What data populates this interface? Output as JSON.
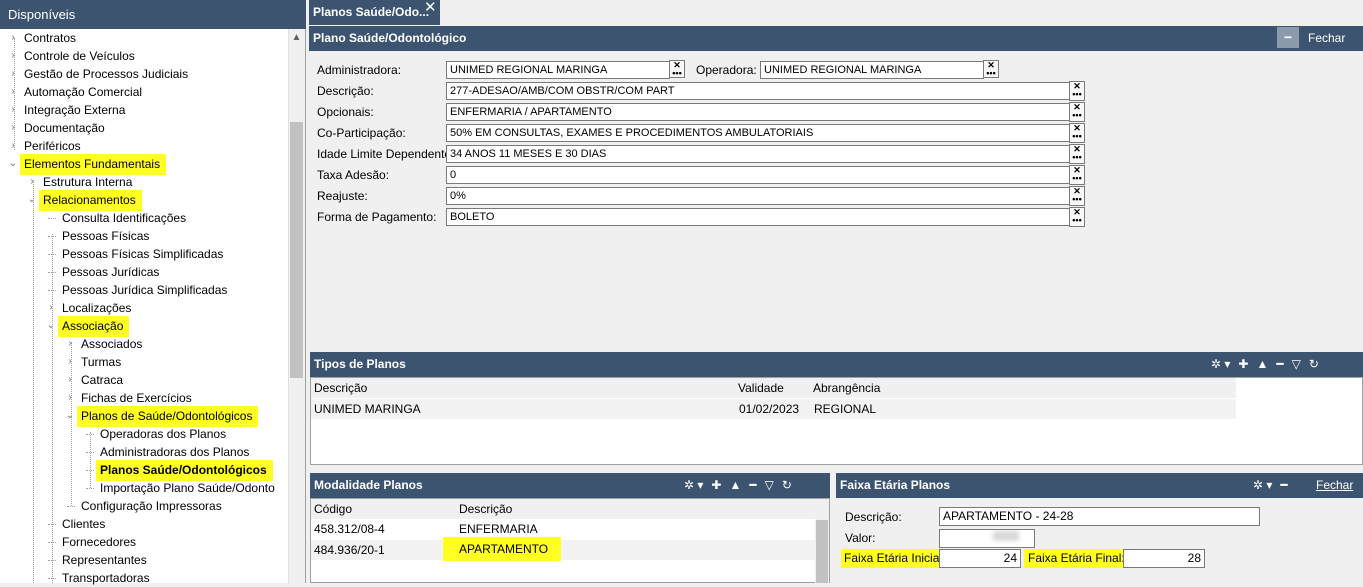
{
  "tree": {
    "title": "Disponíveis",
    "items": [
      {
        "label": "Contratos",
        "level": 0,
        "arrow": ">"
      },
      {
        "label": "Controle de Veículos",
        "level": 0,
        "arrow": ">"
      },
      {
        "label": "Gestão de Processos Judiciais",
        "level": 0,
        "arrow": ">"
      },
      {
        "label": "Automação Comercial",
        "level": 0,
        "arrow": ">"
      },
      {
        "label": "Integração Externa",
        "level": 0,
        "arrow": ">"
      },
      {
        "label": "Documentação",
        "level": 0,
        "arrow": ">"
      },
      {
        "label": "Periféricos",
        "level": 0,
        "arrow": ">"
      },
      {
        "label": "Elementos Fundamentais",
        "level": 0,
        "arrow": "v",
        "highlight": true
      },
      {
        "label": "Estrutura Interna",
        "level": 1,
        "arrow": ">"
      },
      {
        "label": "Relacionamentos",
        "level": 1,
        "arrow": "v",
        "highlight": true
      },
      {
        "label": "Consulta Identificações",
        "level": 2,
        "arrow": ""
      },
      {
        "label": "Pessoas Físicas",
        "level": 2,
        "arrow": ""
      },
      {
        "label": "Pessoas Físicas Simplificadas",
        "level": 2,
        "arrow": ""
      },
      {
        "label": "Pessoas Jurídicas",
        "level": 2,
        "arrow": ""
      },
      {
        "label": "Pessoas Jurídica Simplificadas",
        "level": 2,
        "arrow": ""
      },
      {
        "label": "Localizações",
        "level": 2,
        "arrow": ">"
      },
      {
        "label": "Associação",
        "level": 2,
        "arrow": "v",
        "highlight": true
      },
      {
        "label": "Associados",
        "level": 3,
        "arrow": ">"
      },
      {
        "label": "Turmas",
        "level": 3,
        "arrow": ">"
      },
      {
        "label": "Catraca",
        "level": 3,
        "arrow": ">"
      },
      {
        "label": "Fichas de Exercícios",
        "level": 3,
        "arrow": ">"
      },
      {
        "label": "Planos de Saúde/Odontológicos",
        "level": 3,
        "arrow": "v",
        "highlight": true
      },
      {
        "label": "Operadoras dos Planos",
        "level": 4,
        "arrow": ""
      },
      {
        "label": "Administradoras dos Planos",
        "level": 4,
        "arrow": ""
      },
      {
        "label": "Planos Saúde/Odontológicos",
        "level": 4,
        "arrow": "",
        "highlight": true,
        "bold": true
      },
      {
        "label": "Importação Plano Saúde/Odonto",
        "level": 4,
        "arrow": ""
      },
      {
        "label": "Configuração Impressoras",
        "level": 3,
        "arrow": ""
      },
      {
        "label": "Clientes",
        "level": 2,
        "arrow": ""
      },
      {
        "label": "Fornecedores",
        "level": 2,
        "arrow": ""
      },
      {
        "label": "Representantes",
        "level": 2,
        "arrow": ""
      },
      {
        "label": "Transportadoras",
        "level": 2,
        "arrow": ""
      }
    ]
  },
  "tab": {
    "label": "Planos Saúde/Odo...",
    "close": "✕"
  },
  "main": {
    "title": "Plano Saúde/Odontológico",
    "minimize": "−",
    "close_label": "Fechar",
    "administradora_label": "Administradora:",
    "administradora_value": "UNIMED REGIONAL MARINGA",
    "operadora_label": "Operadora:",
    "operadora_value": "UNIMED REGIONAL MARINGA",
    "fields": [
      {
        "label": "Descrição:",
        "value": "277-ADESAO/AMB/COM OBSTR/COM PART"
      },
      {
        "label": "Opcionais:",
        "value": "ENFERMARIA / APARTAMENTO"
      },
      {
        "label": "Co-Participação:",
        "value": "50% EM CONSULTAS, EXAMES E PROCEDIMENTOS AMBULATORIAIS"
      },
      {
        "label": "Idade Limite Dependente:",
        "value": "34 ANOS 11 MESES E 30 DIAS"
      },
      {
        "label": "Taxa Adesão:",
        "value": "0"
      },
      {
        "label": "Reajuste:",
        "value": "0%"
      },
      {
        "label": "Forma de Pagamento:",
        "value": "BOLETO"
      }
    ]
  },
  "tipos": {
    "title": "Tipos de Planos",
    "columns": [
      "Descrição",
      "Validade",
      "Abrangência"
    ],
    "rows": [
      [
        "UNIMED MARINGA",
        "01/02/2023",
        "REGIONAL"
      ]
    ]
  },
  "modalidade": {
    "title": "Modalidade Planos",
    "columns": [
      "Código",
      "Descrição"
    ],
    "rows": [
      [
        "458.312/08-4",
        "ENFERMARIA"
      ],
      [
        "484.936/20-1",
        "APARTAMENTO"
      ]
    ]
  },
  "faixa": {
    "title": "Faixa Etária Planos",
    "close_label": "Fechar",
    "descricao_label": "Descrição:",
    "descricao_value": "APARTAMENTO - 24-28",
    "valor_label": "Valor:",
    "inicial_label": "Faixa Etária Inicial:",
    "inicial_value": "24",
    "final_label": "Faixa Etária Final:",
    "final_value": "28"
  },
  "icons": {
    "toolbar": [
      "filter-icon",
      "add-icon",
      "up-icon",
      "remove-icon",
      "funnel-icon",
      "refresh-icon"
    ]
  },
  "colors": {
    "header": "#3d5470",
    "highlight": "#ffff22"
  }
}
